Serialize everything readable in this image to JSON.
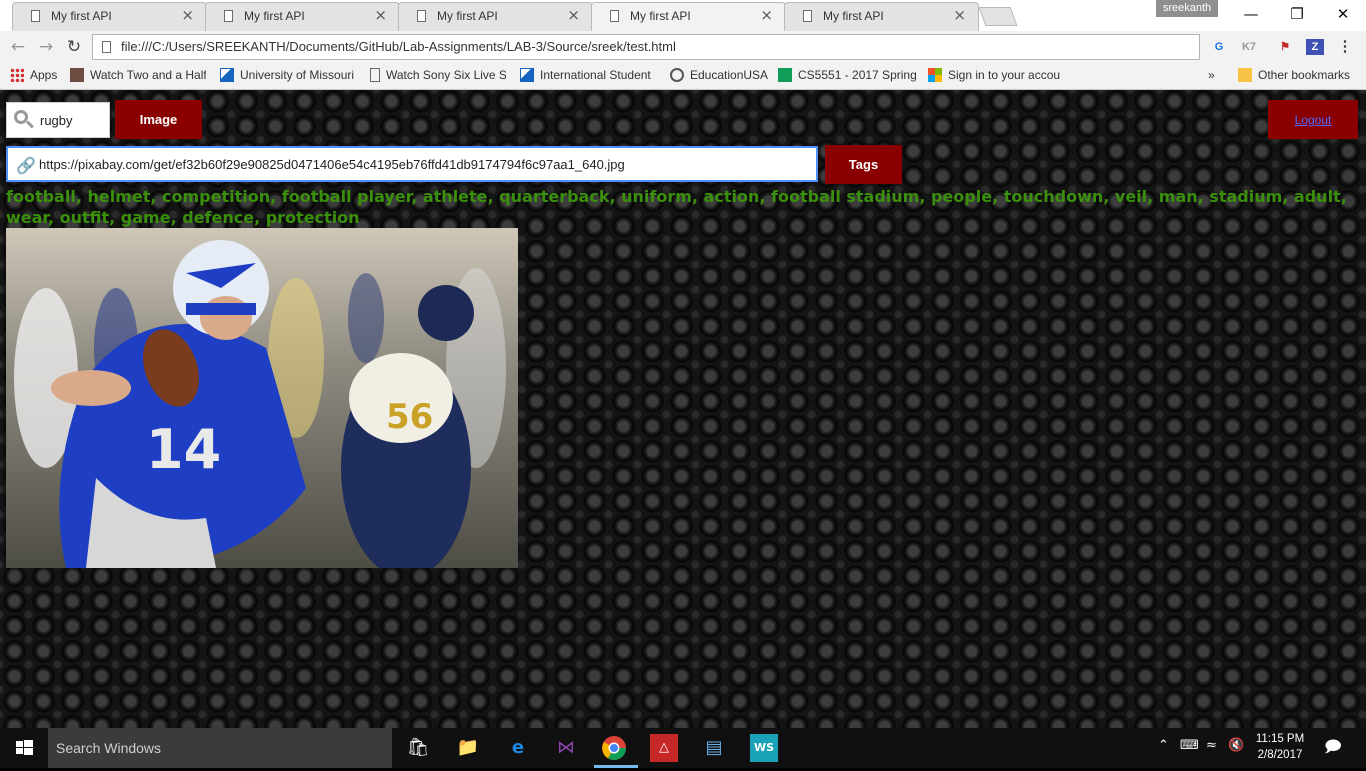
{
  "browser": {
    "tabs": [
      {
        "title": "My first API",
        "active": false
      },
      {
        "title": "My first API",
        "active": false
      },
      {
        "title": "My first API",
        "active": false
      },
      {
        "title": "My first API",
        "active": true
      },
      {
        "title": "My first API",
        "active": false
      }
    ],
    "profile_name": "sreekanth",
    "address": "file:///C:/Users/SREEKANTH/Documents/GitHub/Lab-Assignments/LAB-3/Source/sreek/test.html",
    "extensions": [
      "K7",
      "Z"
    ],
    "bookmarks": [
      {
        "label": "Apps",
        "icon": "apps-grid-icon"
      },
      {
        "label": "Watch Two and a Half",
        "icon": "film-icon"
      },
      {
        "label": "University of Missouri",
        "icon": "university-icon"
      },
      {
        "label": "Watch Sony Six Live S",
        "icon": "page-icon"
      },
      {
        "label": "International Student",
        "icon": "university-icon"
      },
      {
        "label": "EducationUSA",
        "icon": "seal-icon"
      },
      {
        "label": "CS5551 - 2017 Spring",
        "icon": "sheet-icon"
      },
      {
        "label": "Sign in to your accou",
        "icon": "microsoft-icon"
      }
    ],
    "overflow_label": "»",
    "other_bookmarks": "Other bookmarks"
  },
  "app": {
    "search_value": "rugby",
    "image_button": "Image",
    "logout_link": "Logout",
    "image_url": "https://pixabay.com/get/ef32b60f29e90825d0471406e54c4195eb76ffd41db9174794f6c97aa1_640.jpg",
    "tags_button": "Tags",
    "tags_result": "football, helmet, competition, football player, athlete, quarterback, uniform, action, football stadium, people, touchdown, veil, man, stadium, adult, wear, outfit, game, defence, protection",
    "photo": {
      "jersey_left": "14",
      "jersey_right": "56"
    }
  },
  "taskbar": {
    "search_placeholder": "Search Windows",
    "time": "11:15 PM",
    "date": "2/8/2017"
  },
  "colors": {
    "accent_button": "#8a0000",
    "tags_text": "#3a8f0c",
    "focus_border": "#4d90fe"
  }
}
